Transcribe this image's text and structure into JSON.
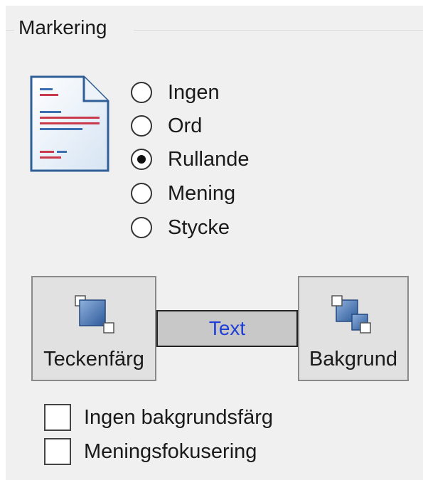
{
  "group": {
    "title": "Markering"
  },
  "icons": {
    "document": "document-icon",
    "text_color": "text-color-icon",
    "background": "background-color-icon"
  },
  "radios": [
    {
      "label": "Ingen",
      "checked": false
    },
    {
      "label": "Ord",
      "checked": false
    },
    {
      "label": "Rullande",
      "checked": true
    },
    {
      "label": "Mening",
      "checked": false
    },
    {
      "label": "Stycke",
      "checked": false
    }
  ],
  "colors": {
    "text_color_button": "Teckenfärg",
    "background_button": "Bakgrund",
    "preview_text": "Text",
    "preview_text_color": "#1f3fd6",
    "preview_background": "#c8c8c8"
  },
  "checkboxes": [
    {
      "label": "Ingen bakgrundsfärg",
      "checked": false
    },
    {
      "label": "Meningsfokusering",
      "checked": false
    }
  ]
}
